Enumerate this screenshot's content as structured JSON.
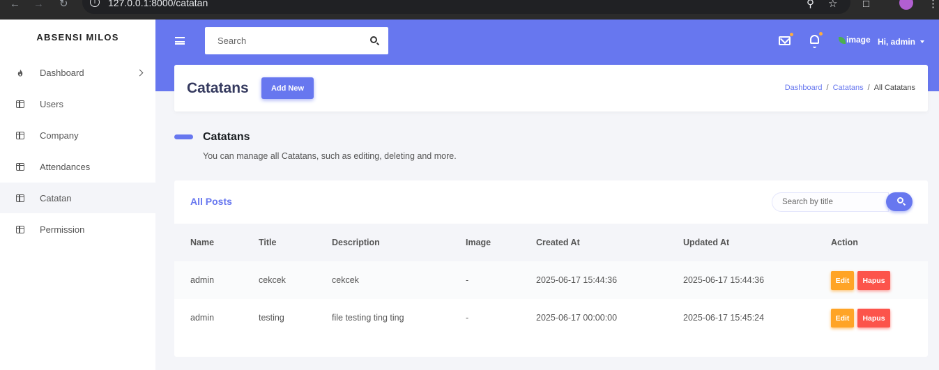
{
  "browser": {
    "url": "127.0.0.1:8000/catatan"
  },
  "sidebar": {
    "brand": "ABSENSI MILOS",
    "items": [
      {
        "label": "Dashboard",
        "icon": "fire-icon"
      },
      {
        "label": "Users",
        "icon": "columns-icon"
      },
      {
        "label": "Company",
        "icon": "columns-icon"
      },
      {
        "label": "Attendances",
        "icon": "columns-icon"
      },
      {
        "label": "Catatan",
        "icon": "columns-icon",
        "active": true
      },
      {
        "label": "Permission",
        "icon": "columns-icon"
      }
    ]
  },
  "header": {
    "search_placeholder": "Search",
    "avatar_alt": "image",
    "greeting": "Hi, admin"
  },
  "page": {
    "title": "Catatans",
    "add_new_label": "Add New",
    "breadcrumb": [
      "Dashboard",
      "Catatans",
      "All Catatans"
    ]
  },
  "section": {
    "title": "Catatans",
    "lead": "You can manage all Catatans, such as editing, deleting and more."
  },
  "posts": {
    "card_title": "All Posts",
    "search_placeholder": "Search by title",
    "columns": [
      "Name",
      "Title",
      "Description",
      "Image",
      "Created At",
      "Updated At",
      "Action"
    ],
    "rows": [
      {
        "name": "admin",
        "title": "cekcek",
        "description": "cekcek",
        "image": "-",
        "created_at": "2025-06-17 15:44:36",
        "updated_at": "2025-06-17 15:44:36",
        "edit": "Edit",
        "delete": "Hapus"
      },
      {
        "name": "admin",
        "title": "testing",
        "description": "file testing ting ting",
        "image": "-",
        "created_at": "2025-06-17 00:00:00",
        "updated_at": "2025-06-17 15:45:24",
        "edit": "Edit",
        "delete": "Hapus"
      }
    ]
  },
  "colors": {
    "primary": "#6777ef",
    "warning": "#ffa426",
    "danger": "#fc544b"
  }
}
